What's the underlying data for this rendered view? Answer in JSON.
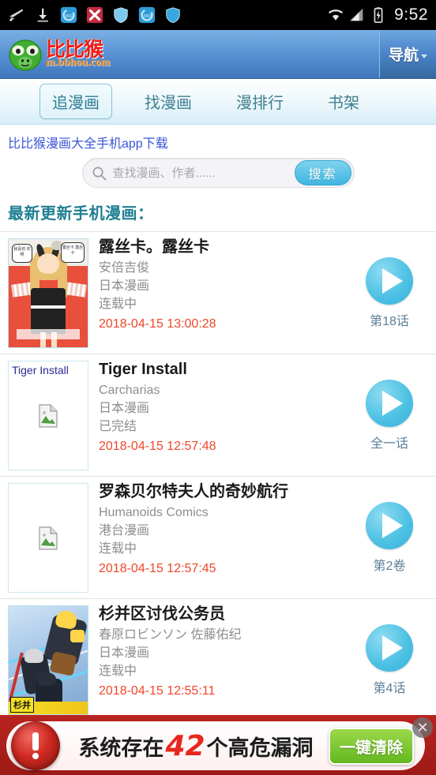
{
  "statusbar": {
    "time": "9:52",
    "left_icons": [
      "plane-icon",
      "download-icon",
      "sync-icon",
      "close-x-icon",
      "shield-icon",
      "sync-icon-2",
      "shield-icon-2"
    ],
    "right_icons": [
      "wifi-icon",
      "signal-icon",
      "battery-charging-icon"
    ]
  },
  "header": {
    "logo_icon": "monkey-logo-icon",
    "brand_cn": "比比猴",
    "brand_url": "m.bbhou.com",
    "nav_button": "导航",
    "nav_caret_icon": "chevron-down-icon",
    "accent_blue": "#5b95d6"
  },
  "tabs": [
    {
      "label": "追漫画",
      "active": true
    },
    {
      "label": "找漫画",
      "active": false
    },
    {
      "label": "漫排行",
      "active": false
    },
    {
      "label": "书架",
      "active": false
    }
  ],
  "app_link": "比比猴漫画大全手机app下载",
  "search": {
    "icon": "search-icon",
    "value": "",
    "placeholder": "查找漫画、作者......",
    "button_label": "搜索",
    "button_color": "#3fb6e0"
  },
  "section": {
    "title": "最新更新手机漫画：",
    "title_color": "#1f7f92"
  },
  "items": [
    {
      "title": "露丝卡。露丝卡",
      "author": "安倍吉俊",
      "category": "日本漫画",
      "status": "连载中",
      "date": "2018-04-15 13:00:28",
      "chapter": "第18话",
      "thumb_kind": "cover-art-1",
      "thumb_alt": "",
      "bubble1": "我喜欢\n你啊",
      "bubble2": "露丝卡\n露丝卡"
    },
    {
      "title": "Tiger Install",
      "author": "Carcharias",
      "category": "日本漫画",
      "status": "已完结",
      "date": "2018-04-15 12:57:48",
      "chapter": "全一话",
      "thumb_kind": "broken-image",
      "thumb_alt": "Tiger Install"
    },
    {
      "title": "罗森贝尔特夫人的奇妙航行",
      "author": "Humanoids Comics",
      "category": "港台漫画",
      "status": "连载中",
      "date": "2018-04-15 12:57:45",
      "chapter": "第2卷",
      "thumb_kind": "broken-image",
      "thumb_alt": ""
    },
    {
      "title": "杉并区讨伐公务员",
      "author": "春原ロビンソン 佐藤佑纪",
      "category": "日本漫画",
      "status": "连载中",
      "date": "2018-04-15 12:55:11",
      "chapter": "第4话",
      "thumb_kind": "cover-art-4",
      "thumb_alt": "",
      "badge": "杉并"
    }
  ],
  "ad": {
    "warn_icon": "warning-exclamation-icon",
    "text_before": "系统存在",
    "count": "42",
    "text_after": "个高危漏洞",
    "button_label": "一键清除",
    "button_color": "#64b81f",
    "count_color": "#e8271d",
    "close_icon": "close-icon"
  }
}
